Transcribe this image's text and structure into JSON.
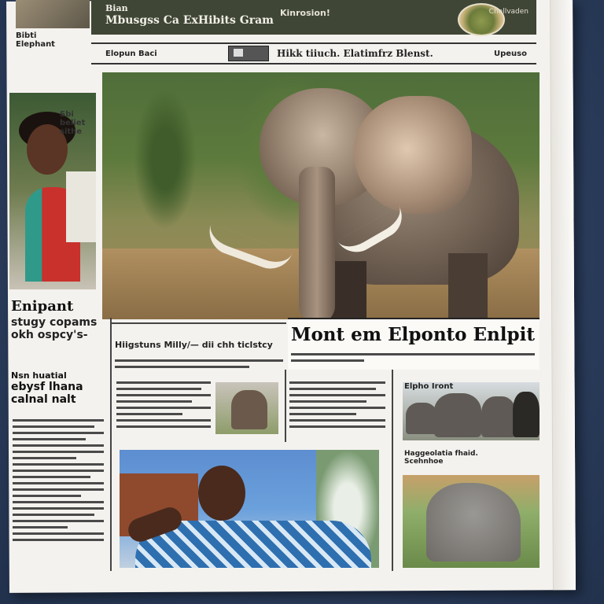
{
  "masthead": {
    "corner_label": "Bibti\nElephant",
    "title_top": "Bian",
    "title": "Mbusgss Ca ExHibits Gram",
    "subtitle": "Kinrosion!",
    "right": "Chellvaden"
  },
  "nav": {
    "left": "Elopun Baci",
    "headline": "Hikk tiiuch. Elatimfrz Blenst.",
    "right": "Upeuso"
  },
  "left_column": {
    "sign_text": "Sbi\nbeliet\nsithe",
    "headline": "Enipant",
    "subhead": "stugy copams\nokh ospcy's-",
    "headline2": "Nsn huatial",
    "bold2": "ebysf lhana\ncalnal nalt"
  },
  "main": {
    "big_headline": "Mont em Elponto Enlpit",
    "sub_headline": "Hiigstuns Milly/— dii chh ticlstcy",
    "right_top_label": "Elpho Iront",
    "right_bot_label": "Haggeolatia fhaid.\nScehnhoe"
  },
  "colors": {
    "masthead_bg": "#3f4635",
    "paper": "#f4f2ee",
    "background": "#2b3d5c"
  }
}
